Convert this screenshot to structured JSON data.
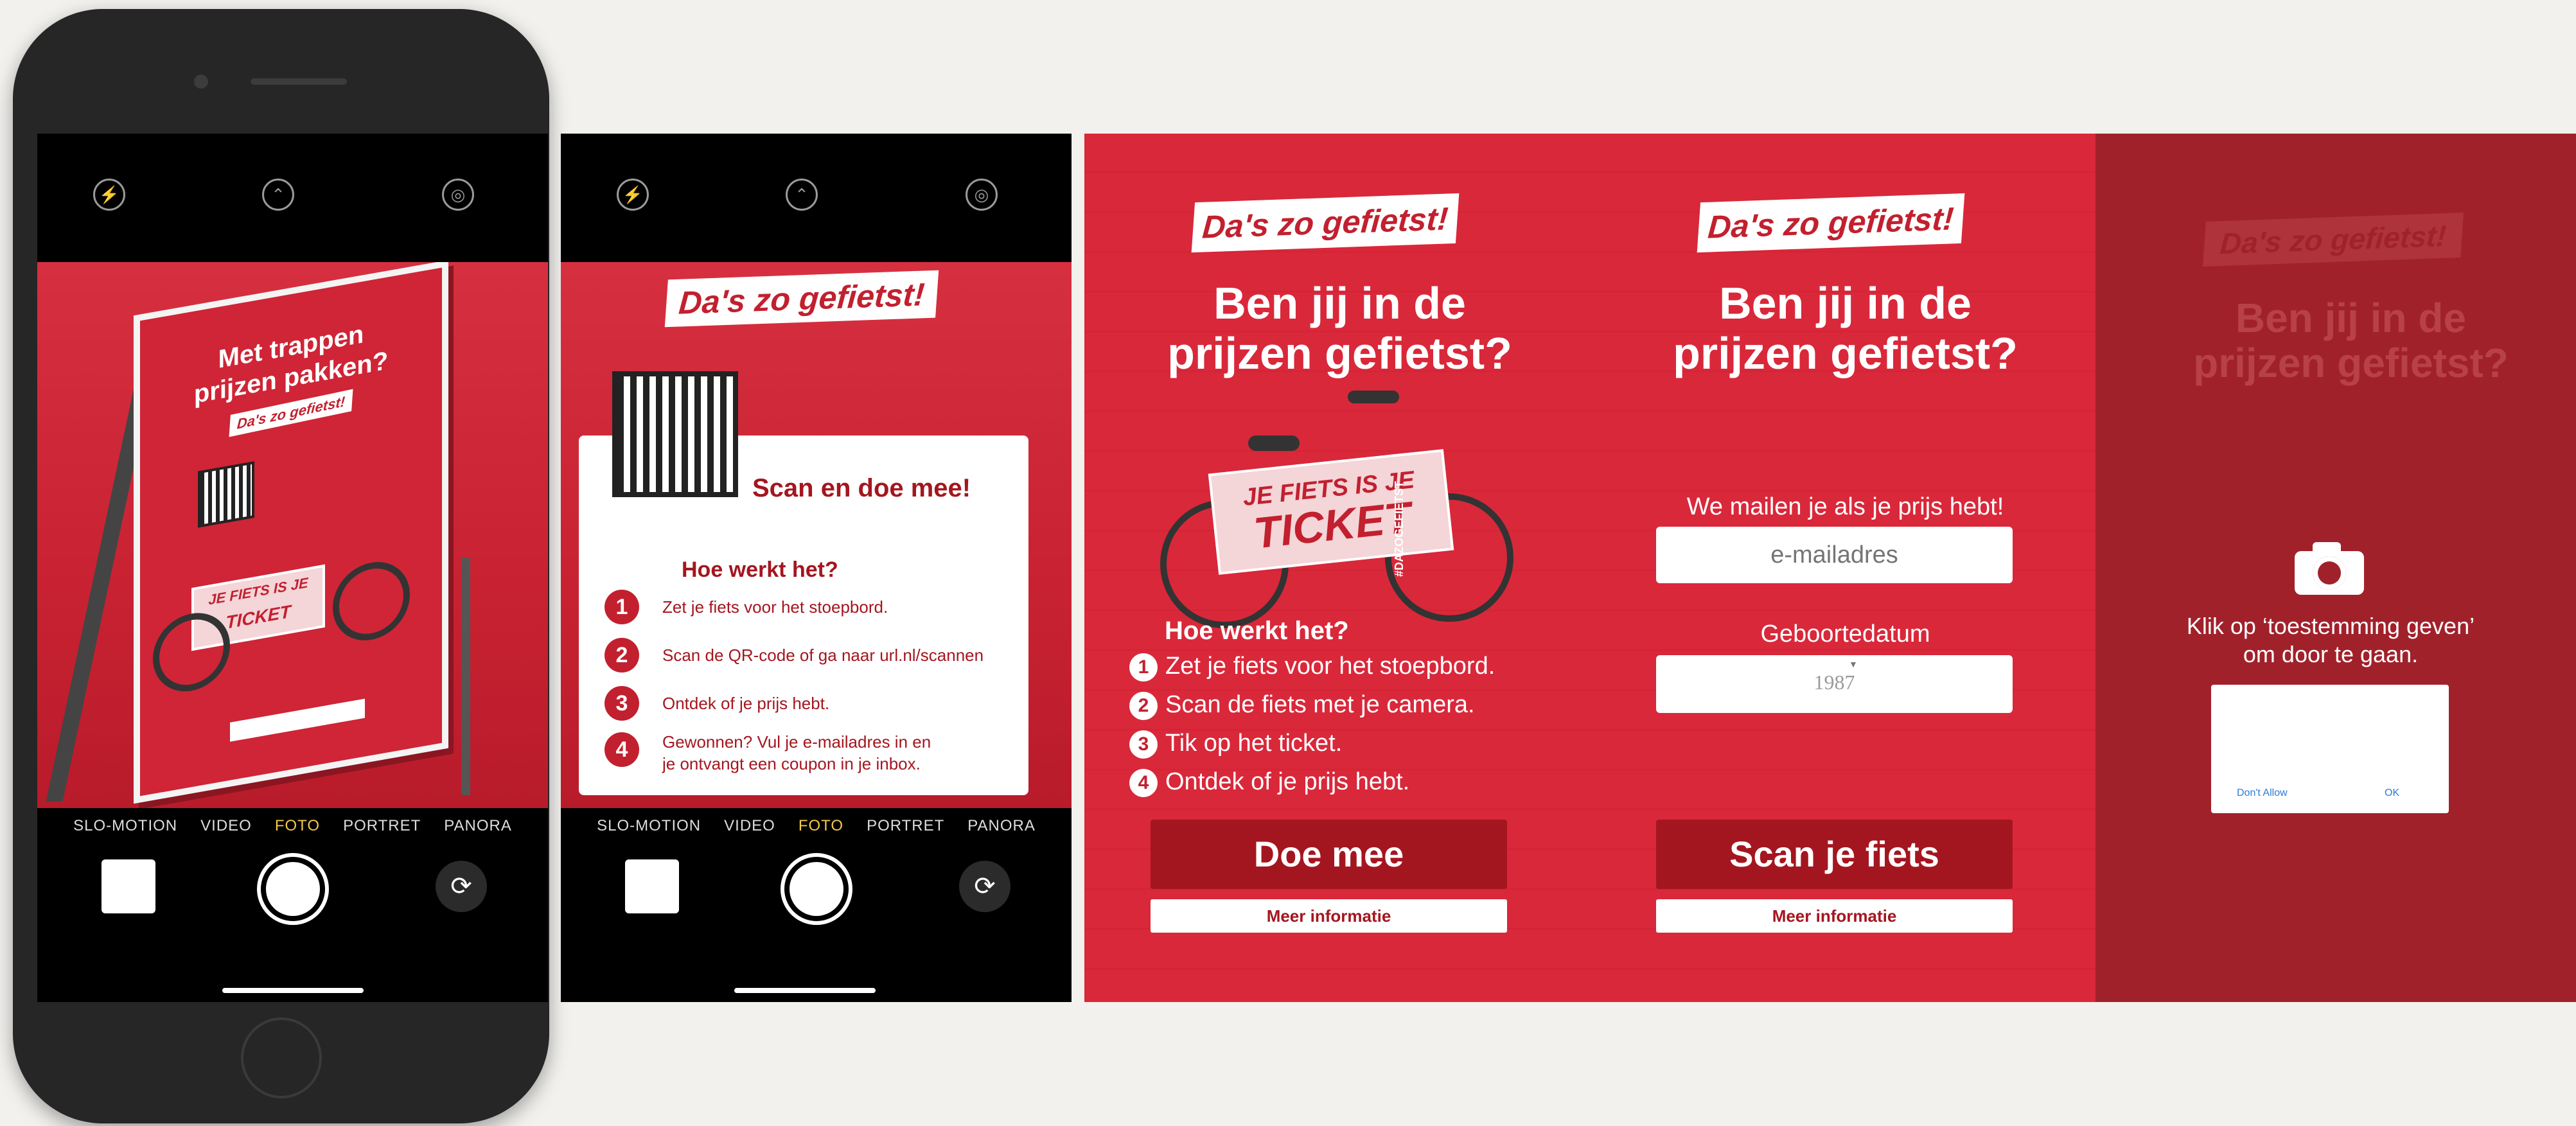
{
  "camera": {
    "modes": [
      "SLO-MOTION",
      "VIDEO",
      "FOTO",
      "PORTRET",
      "PANORA"
    ],
    "active_mode": "FOTO"
  },
  "poster": {
    "headline_line1": "Met trappen",
    "headline_line2": "prijzen pakken?",
    "logo": "Da's zo gefietst!",
    "ticket_line1": "JE FIETS IS JE",
    "ticket_line2": "TICKET"
  },
  "card": {
    "logo": "Da's zo gefietst!",
    "scan_label": "Scan en doe mee!",
    "how_title": "Hoe werkt het?",
    "steps": [
      "Zet je fiets voor het stoepbord.",
      "Scan de QR-code of ga naar url.nl/scannen",
      "Ontdek of je prijs hebt.",
      "Gewonnen? Vul je e-mailadres in en",
      "je ontvangt een coupon in je inbox."
    ]
  },
  "landing": {
    "logo": "Da's zo gefietst!",
    "heading_line1": "Ben jij in de",
    "heading_line2": "prijzen gefietst?",
    "ticket_line1": "JE FIETS IS JE",
    "ticket_line2": "TICKET",
    "ticket_side": "#DAZOGEFIETST",
    "how_title": "Hoe werkt het?",
    "steps": [
      "Zet je fiets voor het stoepbord.",
      "Scan de fiets met je camera.",
      "Tik op het ticket.",
      "Ontdek of je prijs hebt."
    ],
    "cta": "Doe mee",
    "more_info": "Meer informatie"
  },
  "form": {
    "logo": "Da's zo gefietst!",
    "heading_line1": "Ben jij in de",
    "heading_line2": "prijzen gefietst?",
    "email_label": "We mailen je als je prijs hebt!",
    "email_placeholder": "e-mailadres",
    "dob_label": "Geboortedatum",
    "dob_value": "1987",
    "cta": "Scan je fiets",
    "more_info": "Meer informatie"
  },
  "permission": {
    "logo": "Da's zo gefietst!",
    "heading_line1": "Ben jij in de",
    "heading_line2": "prijzen gefietst?",
    "message_line1": "Klik op ‘toestemming geven’",
    "message_line2": "om door te gaan.",
    "dont_allow": "Don't Allow",
    "ok": "OK"
  },
  "colors": {
    "brand_red": "#d9283a",
    "dark_red": "#a4161f",
    "active_mode": "#f5c84a"
  }
}
